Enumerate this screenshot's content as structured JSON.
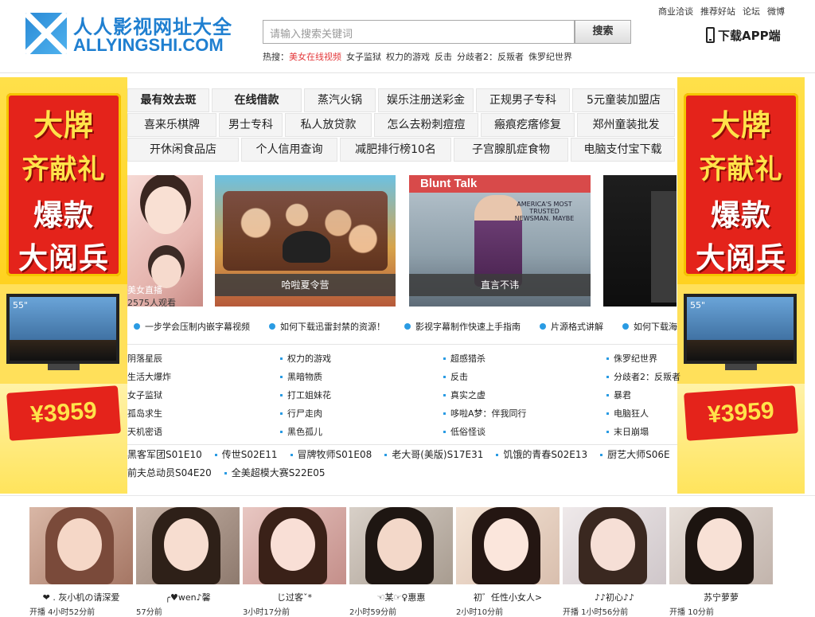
{
  "header": {
    "logo_cn": "人人影视网址大全",
    "logo_en": "ALLYINGSHI.COM",
    "search_placeholder": "请输入搜索关键词",
    "search_button": "搜索",
    "hot_label": "热搜：",
    "hot_items": [
      "美女在线视频",
      "女子监狱",
      "权力的游戏",
      "反击",
      "分歧者2：反叛者",
      "侏罗纪世界"
    ],
    "top_links": [
      "商业洽谈",
      "推荐好站",
      "论坛",
      "微博"
    ],
    "app_link": "下载APP端"
  },
  "side_ad": {
    "line1": "大牌",
    "line2": "齐献礼",
    "line3": "爆款",
    "line4": "大阅兵",
    "tv_size": "55\"",
    "price": "¥3959"
  },
  "keywords": [
    [
      "最有效去斑",
      "在线借款",
      "蒸汽火锅",
      "娱乐注册送彩金",
      "正规男子专科",
      "5元童装加盟店"
    ],
    [
      "喜来乐棋牌",
      "男士专科",
      "私人放贷款",
      "怎么去粉刺痘痘",
      "瘢痕疙瘩修复",
      "郑州童装批发"
    ],
    [
      "开休闲食品店",
      "个人信用查询",
      "减肥排行榜10名",
      "子宫腺肌症食物",
      "电脑支付宝下载"
    ]
  ],
  "featured": {
    "f1_live": "美女直播",
    "f1_watch": "2575人观看",
    "f2_caption": "哈啦夏令营",
    "f3_title": "Blunt Talk",
    "f3_tag": "AMERICA'S MOST TRUSTED NEWSMAN. MAYBE",
    "f3_caption": "直言不讳"
  },
  "tips": [
    "一步学会压制内嵌字幕视频",
    "如何下载迅雷封禁的资源！",
    "影视字幕制作快速上手指南",
    "片源格式讲解",
    "如何下载海外片源"
  ],
  "titles": [
    [
      "阴落星辰",
      "生活大爆炸",
      "女子监狱",
      "孤岛求生",
      "天机密语"
    ],
    [
      "权力的游戏",
      "黑暗物质",
      "打工姐妹花",
      "行尸走肉",
      "黑色孤儿"
    ],
    [
      "超感猎杀",
      "反击",
      "真实之虚",
      "哆啦A梦：伴我同行",
      "低俗怪谈"
    ],
    [
      "侏罗纪世界",
      "分歧者2：反叛者",
      "暴君",
      "电脑狂人",
      "末日崩塌"
    ]
  ],
  "episodes_row1": [
    "黑客军团S01E10",
    "传世S02E11",
    "冒牌牧师S01E08",
    "老大哥(美版)S17E31",
    "饥饿的青春S02E13",
    "厨艺大师S06E"
  ],
  "episodes_row2": [
    "前夫总动员S04E20",
    "全美超模大赛S22E05"
  ],
  "gallery": [
    {
      "name": "❤ . 灰小机の请深爱",
      "sub": "开播          4小时52分前"
    },
    {
      "name": "╭♥wen♪馨",
      "sub": "          57分前"
    },
    {
      "name": "じ过客ˇ*",
      "sub": "          3小时17分前"
    },
    {
      "name": "☜某☞♀惠惠",
      "sub": "          2小时59分前"
    },
    {
      "name": "初゛任性小女人>",
      "sub": "          2小时10分前"
    },
    {
      "name": "♪♪初心♪♪",
      "sub": "开播          1小时56分前"
    },
    {
      "name": "苏宁萝萝",
      "sub": "开播          10分前"
    }
  ],
  "colors": {
    "brand_blue": "#1f7fd0",
    "hot_red": "#e4393c",
    "ad_red": "#e4231b",
    "ad_yellow": "#ffe05a",
    "accent_dot": "#2a9be3"
  }
}
